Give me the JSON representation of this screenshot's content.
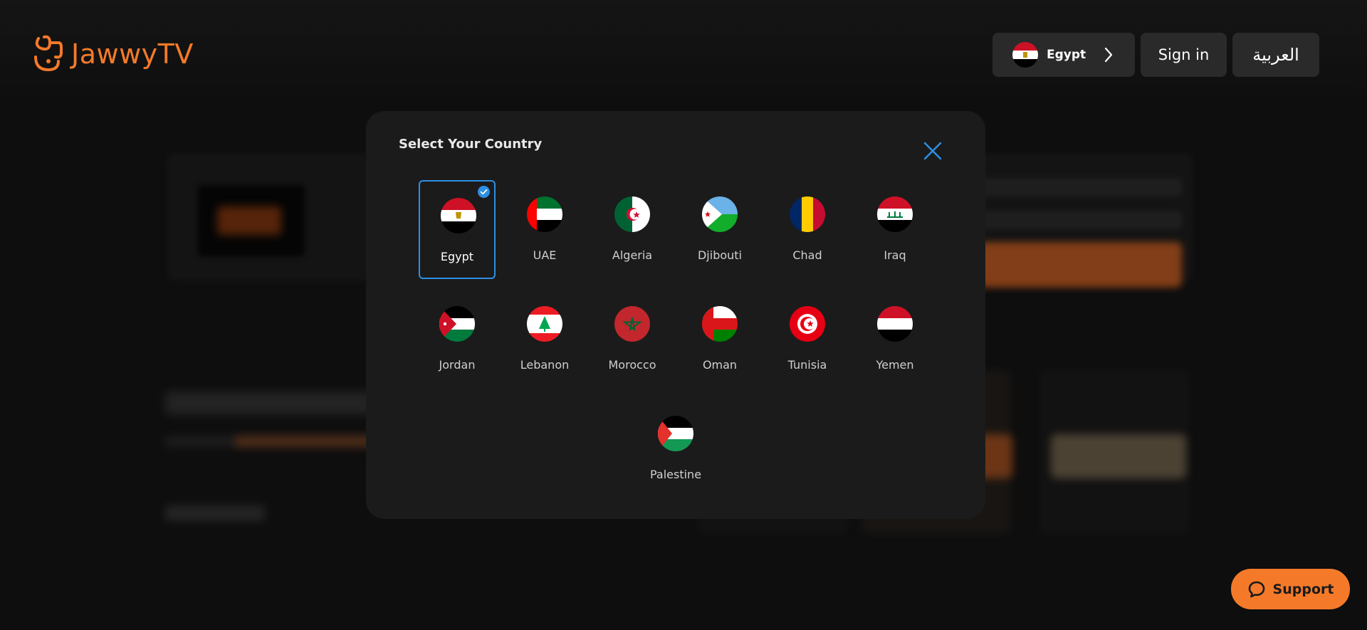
{
  "header": {
    "logo_text": "JawwyTV",
    "country_button": {
      "label": "Egypt",
      "flag_icon": "egypt-flag-icon"
    },
    "signin_label": "Sign in",
    "language_label": "العربية"
  },
  "modal": {
    "title": "Select Your Country",
    "selected": "Egypt",
    "countries": [
      {
        "label": "Egypt",
        "flag": "egypt-flag"
      },
      {
        "label": "UAE",
        "flag": "uae-flag"
      },
      {
        "label": "Algeria",
        "flag": "algeria-flag"
      },
      {
        "label": "Djibouti",
        "flag": "djibouti-flag"
      },
      {
        "label": "Chad",
        "flag": "chad-flag"
      },
      {
        "label": "Iraq",
        "flag": "iraq-flag"
      },
      {
        "label": "Jordan",
        "flag": "jordan-flag"
      },
      {
        "label": "Lebanon",
        "flag": "lebanon-flag"
      },
      {
        "label": "Morocco",
        "flag": "morocco-flag"
      },
      {
        "label": "Oman",
        "flag": "oman-flag"
      },
      {
        "label": "Tunisia",
        "flag": "tunisia-flag"
      },
      {
        "label": "Yemen",
        "flag": "yemen-flag"
      },
      {
        "label": "Palestine",
        "flag": "palestine-flag"
      }
    ]
  },
  "support": {
    "label": "Support"
  },
  "colors": {
    "accent": "#f47a2a",
    "selection": "#2d8fe3",
    "modal_bg": "#1b1b1b",
    "page_bg": "#0e0e0e"
  }
}
